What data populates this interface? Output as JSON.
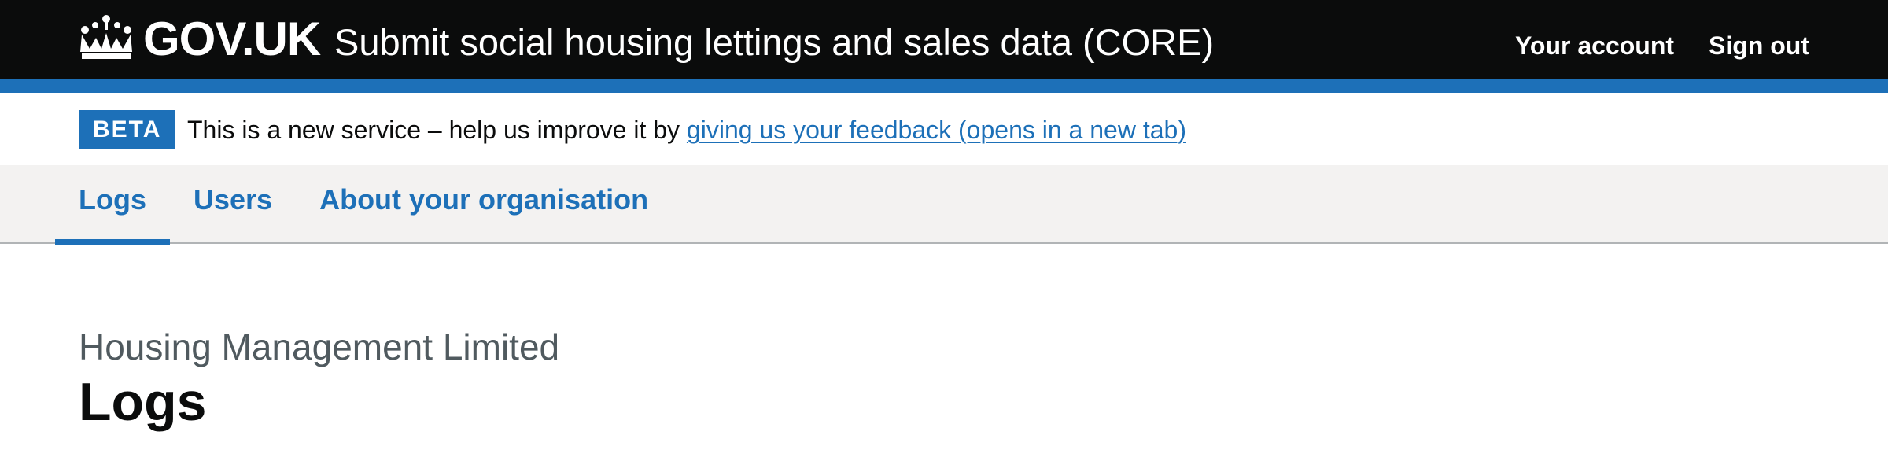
{
  "header": {
    "logotype": "GOV.UK",
    "service_name": "Submit social housing lettings and sales data (CORE)",
    "nav": [
      {
        "label": "Your account"
      },
      {
        "label": "Sign out"
      }
    ],
    "icon": "crown-icon"
  },
  "phase_banner": {
    "tag": "BETA",
    "text": "This is a new service – help us improve it by ",
    "link": "giving us your feedback (opens in a new tab)"
  },
  "primary_nav": {
    "items": [
      {
        "label": "Logs",
        "active": true
      },
      {
        "label": "Users",
        "active": false
      },
      {
        "label": "About your organisation",
        "active": false
      }
    ]
  },
  "main": {
    "caption": "Housing Management Limited",
    "title": "Logs"
  },
  "colors": {
    "header_bg": "#0b0c0c",
    "brand_blue": "#1d70b8",
    "nav_bg": "#f3f2f1",
    "secondary_text": "#505a5f"
  }
}
